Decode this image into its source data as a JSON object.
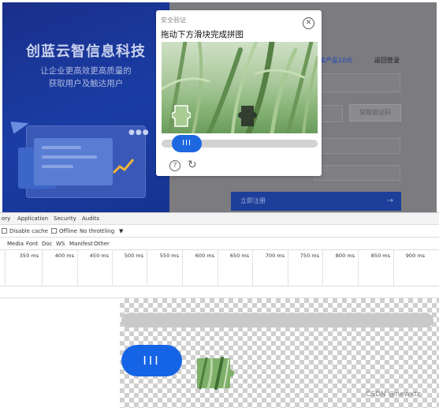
{
  "banner": {
    "title": "创蓝云智信息科技",
    "subtitle_line1": "让企业更高效更高质量的",
    "subtitle_line2": "获取用户及触达用户"
  },
  "right_pane": {
    "link_products": "美产品10元",
    "link_back_login": "返回登录",
    "get_code_button": "获取验证码",
    "register_button": "立即注册",
    "register_arrow": "→"
  },
  "captcha": {
    "tag": "安全验证",
    "title": "拖动下方滑块完成拼图",
    "close_glyph": "✕",
    "slider_knob_glyph": "III",
    "help_glyph": "?",
    "refresh_glyph": "↻",
    "slider_progress": 0.07
  },
  "devtools": {
    "tabs": [
      "ory",
      "Application",
      "Security",
      "Audits"
    ],
    "toolbar": {
      "disable_cache": "Disable cache",
      "offline": "Offline",
      "throttling": "No throttling",
      "throttling_caret": "▼"
    },
    "filters": [
      "Media",
      "Font",
      "Doc",
      "WS",
      "Manifest",
      "Other"
    ],
    "timeline_ticks": [
      "350 ms",
      "400 ms",
      "450 ms",
      "500 ms",
      "550 ms",
      "600 ms",
      "650 ms",
      "700 ms",
      "750 ms",
      "800 ms",
      "850 ms",
      "900 ms"
    ]
  },
  "preview": {
    "knob_glyph": "III"
  },
  "watermark": "CSDN @newxtc",
  "colors": {
    "accent_blue": "#1564e6",
    "banner_blue": "#1a3da5"
  }
}
